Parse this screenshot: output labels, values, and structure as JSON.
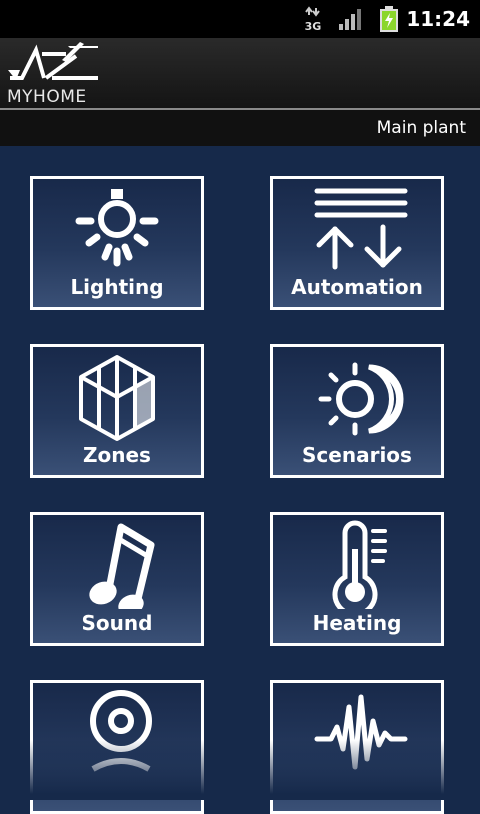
{
  "status_bar": {
    "network_icon": "3g-icon",
    "signal_icon": "signal-icon",
    "battery_icon": "battery-charging-icon",
    "network_label": "3G",
    "time": "11:24"
  },
  "header": {
    "logo_text": "MYHOME",
    "plant_name": "Main plant"
  },
  "menu": [
    {
      "label": "Lighting",
      "icon": "light-bulb-icon"
    },
    {
      "label": "Automation",
      "icon": "shutter-arrows-icon"
    },
    {
      "label": "Zones",
      "icon": "cube-zones-icon"
    },
    {
      "label": "Scenarios",
      "icon": "sun-moon-icon"
    },
    {
      "label": "Sound",
      "icon": "music-note-icon"
    },
    {
      "label": "Heating",
      "icon": "thermometer-icon"
    },
    {
      "label": "",
      "icon": "webcam-icon"
    },
    {
      "label": "",
      "icon": "waveform-icon"
    }
  ],
  "colors": {
    "background": "#16294a",
    "tile_border": "#ffffff",
    "battery": "#8bd62c"
  }
}
